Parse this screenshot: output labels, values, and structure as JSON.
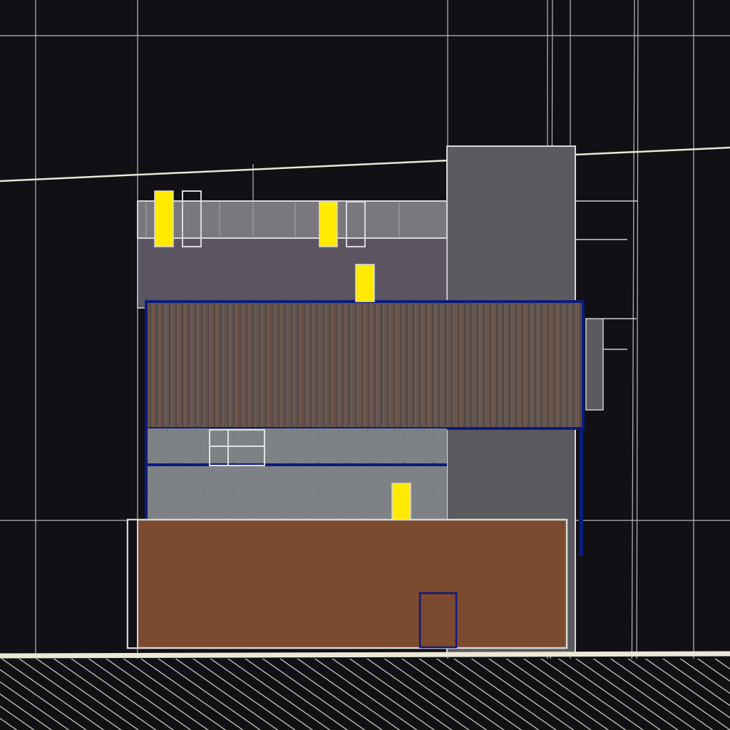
{
  "view": {
    "type": "architectural-elevation",
    "background": "#121015"
  },
  "palette": {
    "background": "#121015",
    "grid_line": "#b9b9bd",
    "ground_line": "#ece8d6",
    "facade_gray": "#5a5560",
    "facade_light": "#7b777e",
    "tower_gray": "#5b5b5f",
    "wood_cladding": "#5f4f4a",
    "concrete": "#7d8084",
    "terracotta": "#7c4a2e",
    "outline_blue": "#0b1b7e",
    "window_yellow": "#ffea00",
    "outline_white": "#e6e6e6"
  },
  "elements": {
    "ground": "ground-hatch",
    "roof_line": "sloped-datum-line",
    "tower": "stair-tower",
    "upper_floor": "upper-facade",
    "wood_band": "wood-cladding-band",
    "concrete_band": "concrete-band",
    "base_block": "terracotta-base",
    "entrance": "entrance-door",
    "windows": [
      "window-1",
      "window-2",
      "window-3",
      "window-4"
    ]
  }
}
